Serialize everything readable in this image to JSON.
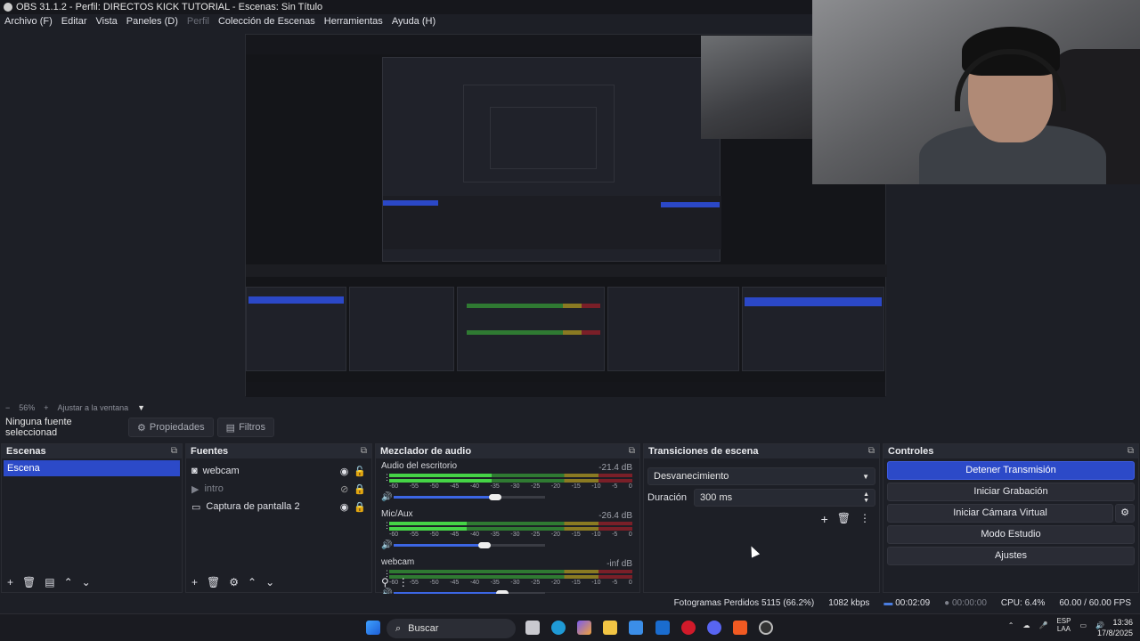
{
  "window": {
    "title": "OBS 31.1.2 - Perfil: DIRECTOS KICK TUTORIAL - Escenas: Sin Título"
  },
  "menu": [
    "Archivo (F)",
    "Editar",
    "Vista",
    "Paneles (D)",
    "Perfil",
    "Colección de Escenas",
    "Herramientas",
    "Ayuda (H)"
  ],
  "zoom": {
    "minus": "−",
    "value": "56%",
    "plus": "+",
    "fit": "Ajustar a la ventana"
  },
  "sourcebar": {
    "selected": "Ninguna fuente seleccionad",
    "properties": "Propiedades",
    "filters": "Filtros"
  },
  "scenes": {
    "title": "Escenas",
    "items": [
      "Escena"
    ]
  },
  "sources": {
    "title": "Fuentes",
    "items": [
      {
        "name": "webcam",
        "icon": "camera-icon"
      },
      {
        "name": "intro",
        "icon": "play-icon"
      },
      {
        "name": "Captura de pantalla 2",
        "icon": "monitor-icon"
      }
    ]
  },
  "mixer": {
    "title": "Mezclador de audio",
    "channels": [
      {
        "name": "Audio del escritorio",
        "db": "-21.4 dB",
        "level": 0.42,
        "volume": 0.93
      },
      {
        "name": "Mic/Aux",
        "db": "-26.4 dB",
        "level": 0.32,
        "volume": 0.83
      },
      {
        "name": "webcam",
        "db": "-inf dB",
        "level": 0,
        "volume": 1
      }
    ],
    "ticks": [
      "-60",
      "-55",
      "-50",
      "-45",
      "-40",
      "-35",
      "-30",
      "-25",
      "-20",
      "-15",
      "-10",
      "-5",
      "0"
    ]
  },
  "transitions": {
    "title": "Transiciones de escena",
    "selected": "Desvanecimiento",
    "duration_label": "Duración",
    "duration": "300 ms"
  },
  "controls": {
    "title": "Controles",
    "stop_stream": "Detener Transmisión",
    "start_record": "Iniciar Grabación",
    "virtual_cam": "Iniciar Cámara Virtual",
    "studio": "Modo Estudio",
    "settings": "Ajustes"
  },
  "status": {
    "dropped": "Fotogramas Perdidos 5115 (66.2%)",
    "bitrate": "1082 kbps",
    "stream_time": "00:02:09",
    "rec_time": "00:00:00",
    "cpu": "CPU: 6.4%",
    "fps": "60.00 / 60.00 FPS"
  },
  "taskbar": {
    "search": "Buscar",
    "lang": "ESP",
    "lang2": "LAA",
    "time": "13:36",
    "date": "17/8/2025"
  }
}
